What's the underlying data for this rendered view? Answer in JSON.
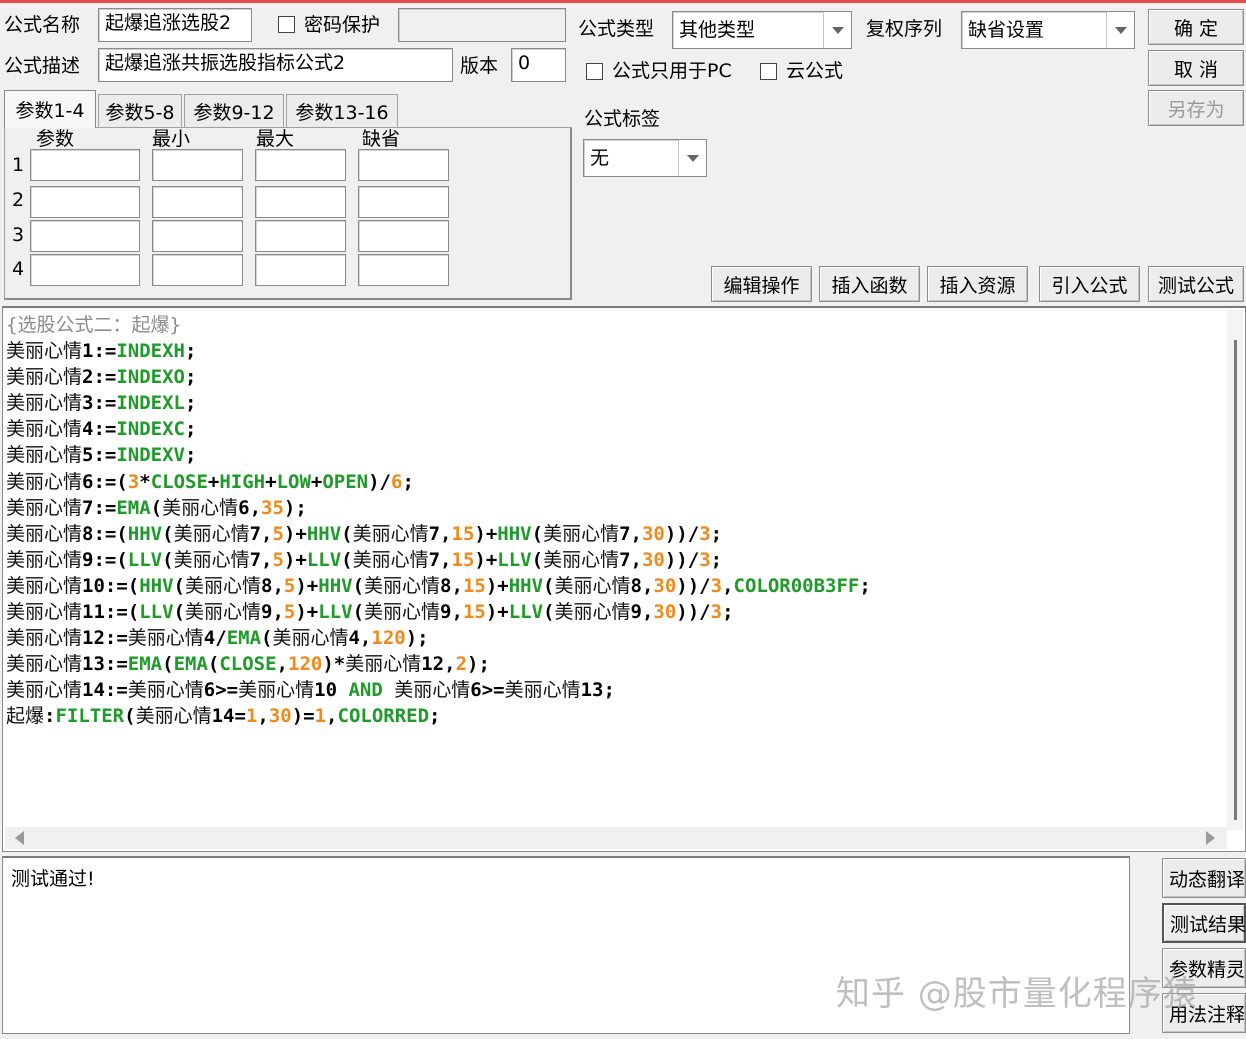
{
  "formula": {
    "name_label": "公式名称",
    "name_value": "起爆追涨选股2",
    "password_label": "密码保护",
    "desc_label": "公式描述",
    "desc_value": "起爆追涨共振选股指标公式2",
    "version_label": "版本",
    "version_value": "0",
    "type_label": "公式类型",
    "type_value": "其他类型",
    "adjust_label": "复权序列",
    "adjust_value": "缺省设置",
    "pc_only_label": "公式只用于PC",
    "cloud_label": "云公式",
    "tag_label": "公式标签",
    "tag_value": "无"
  },
  "dialog_buttons": {
    "ok": "确 定",
    "cancel": "取 消",
    "save_as": "另存为"
  },
  "params": {
    "tabs": [
      "参数1-4",
      "参数5-8",
      "参数9-12",
      "参数13-16"
    ],
    "headers": [
      "参数",
      "最小",
      "最大",
      "缺省"
    ],
    "rows": [
      "1",
      "2",
      "3",
      "4"
    ]
  },
  "action_buttons": {
    "edit": "编辑操作",
    "insert_func": "插入函数",
    "insert_res": "插入资源",
    "import": "引入公式",
    "test": "测试公式"
  },
  "code_lines": [
    [
      {
        "t": "{选股公式二：起爆}",
        "c": "cm"
      }
    ],
    [
      {
        "t": "美丽心情",
        "c": "nm"
      },
      {
        "t": "1:=",
        "c": "op"
      },
      {
        "t": "INDEXH",
        "c": "fn"
      },
      {
        "t": ";",
        "c": "op"
      }
    ],
    [
      {
        "t": "美丽心情",
        "c": "nm"
      },
      {
        "t": "2:=",
        "c": "op"
      },
      {
        "t": "INDEXO",
        "c": "fn"
      },
      {
        "t": ";",
        "c": "op"
      }
    ],
    [
      {
        "t": "美丽心情",
        "c": "nm"
      },
      {
        "t": "3:=",
        "c": "op"
      },
      {
        "t": "INDEXL",
        "c": "fn"
      },
      {
        "t": ";",
        "c": "op"
      }
    ],
    [
      {
        "t": "美丽心情",
        "c": "nm"
      },
      {
        "t": "4:=",
        "c": "op"
      },
      {
        "t": "INDEXC",
        "c": "fn"
      },
      {
        "t": ";",
        "c": "op"
      }
    ],
    [
      {
        "t": "美丽心情",
        "c": "nm"
      },
      {
        "t": "5:=",
        "c": "op"
      },
      {
        "t": "INDEXV",
        "c": "fn"
      },
      {
        "t": ";",
        "c": "op"
      }
    ],
    [
      {
        "t": "美丽心情",
        "c": "nm"
      },
      {
        "t": "6:=(",
        "c": "op"
      },
      {
        "t": "3",
        "c": "num"
      },
      {
        "t": "*",
        "c": "op"
      },
      {
        "t": "CLOSE",
        "c": "fn"
      },
      {
        "t": "+",
        "c": "op"
      },
      {
        "t": "HIGH",
        "c": "fn"
      },
      {
        "t": "+",
        "c": "op"
      },
      {
        "t": "LOW",
        "c": "fn"
      },
      {
        "t": "+",
        "c": "op"
      },
      {
        "t": "OPEN",
        "c": "fn"
      },
      {
        "t": ")/",
        "c": "op"
      },
      {
        "t": "6",
        "c": "num"
      },
      {
        "t": ";",
        "c": "op"
      }
    ],
    [
      {
        "t": "美丽心情",
        "c": "nm"
      },
      {
        "t": "7:=",
        "c": "op"
      },
      {
        "t": "EMA",
        "c": "fn"
      },
      {
        "t": "(",
        "c": "op"
      },
      {
        "t": "美丽心情",
        "c": "nm"
      },
      {
        "t": "6,",
        "c": "op"
      },
      {
        "t": "35",
        "c": "num"
      },
      {
        "t": ");",
        "c": "op"
      }
    ],
    [
      {
        "t": "美丽心情",
        "c": "nm"
      },
      {
        "t": "8:=(",
        "c": "op"
      },
      {
        "t": "HHV",
        "c": "fn"
      },
      {
        "t": "(",
        "c": "op"
      },
      {
        "t": "美丽心情",
        "c": "nm"
      },
      {
        "t": "7,",
        "c": "op"
      },
      {
        "t": "5",
        "c": "num"
      },
      {
        "t": ")+",
        "c": "op"
      },
      {
        "t": "HHV",
        "c": "fn"
      },
      {
        "t": "(",
        "c": "op"
      },
      {
        "t": "美丽心情",
        "c": "nm"
      },
      {
        "t": "7,",
        "c": "op"
      },
      {
        "t": "15",
        "c": "num"
      },
      {
        "t": ")+",
        "c": "op"
      },
      {
        "t": "HHV",
        "c": "fn"
      },
      {
        "t": "(",
        "c": "op"
      },
      {
        "t": "美丽心情",
        "c": "nm"
      },
      {
        "t": "7,",
        "c": "op"
      },
      {
        "t": "30",
        "c": "num"
      },
      {
        "t": "))/",
        "c": "op"
      },
      {
        "t": "3",
        "c": "num"
      },
      {
        "t": ";",
        "c": "op"
      }
    ],
    [
      {
        "t": "美丽心情",
        "c": "nm"
      },
      {
        "t": "9:=(",
        "c": "op"
      },
      {
        "t": "LLV",
        "c": "fn"
      },
      {
        "t": "(",
        "c": "op"
      },
      {
        "t": "美丽心情",
        "c": "nm"
      },
      {
        "t": "7,",
        "c": "op"
      },
      {
        "t": "5",
        "c": "num"
      },
      {
        "t": ")+",
        "c": "op"
      },
      {
        "t": "LLV",
        "c": "fn"
      },
      {
        "t": "(",
        "c": "op"
      },
      {
        "t": "美丽心情",
        "c": "nm"
      },
      {
        "t": "7,",
        "c": "op"
      },
      {
        "t": "15",
        "c": "num"
      },
      {
        "t": ")+",
        "c": "op"
      },
      {
        "t": "LLV",
        "c": "fn"
      },
      {
        "t": "(",
        "c": "op"
      },
      {
        "t": "美丽心情",
        "c": "nm"
      },
      {
        "t": "7,",
        "c": "op"
      },
      {
        "t": "30",
        "c": "num"
      },
      {
        "t": "))/",
        "c": "op"
      },
      {
        "t": "3",
        "c": "num"
      },
      {
        "t": ";",
        "c": "op"
      }
    ],
    [
      {
        "t": "美丽心情",
        "c": "nm"
      },
      {
        "t": "10:=(",
        "c": "op"
      },
      {
        "t": "HHV",
        "c": "fn"
      },
      {
        "t": "(",
        "c": "op"
      },
      {
        "t": "美丽心情",
        "c": "nm"
      },
      {
        "t": "8,",
        "c": "op"
      },
      {
        "t": "5",
        "c": "num"
      },
      {
        "t": ")+",
        "c": "op"
      },
      {
        "t": "HHV",
        "c": "fn"
      },
      {
        "t": "(",
        "c": "op"
      },
      {
        "t": "美丽心情",
        "c": "nm"
      },
      {
        "t": "8,",
        "c": "op"
      },
      {
        "t": "15",
        "c": "num"
      },
      {
        "t": ")+",
        "c": "op"
      },
      {
        "t": "HHV",
        "c": "fn"
      },
      {
        "t": "(",
        "c": "op"
      },
      {
        "t": "美丽心情",
        "c": "nm"
      },
      {
        "t": "8,",
        "c": "op"
      },
      {
        "t": "30",
        "c": "num"
      },
      {
        "t": "))/",
        "c": "op"
      },
      {
        "t": "3",
        "c": "num"
      },
      {
        "t": ",",
        "c": "op"
      },
      {
        "t": "COLOR00B3FF",
        "c": "cl"
      },
      {
        "t": ";",
        "c": "op"
      }
    ],
    [
      {
        "t": "美丽心情",
        "c": "nm"
      },
      {
        "t": "11:=(",
        "c": "op"
      },
      {
        "t": "LLV",
        "c": "fn"
      },
      {
        "t": "(",
        "c": "op"
      },
      {
        "t": "美丽心情",
        "c": "nm"
      },
      {
        "t": "9,",
        "c": "op"
      },
      {
        "t": "5",
        "c": "num"
      },
      {
        "t": ")+",
        "c": "op"
      },
      {
        "t": "LLV",
        "c": "fn"
      },
      {
        "t": "(",
        "c": "op"
      },
      {
        "t": "美丽心情",
        "c": "nm"
      },
      {
        "t": "9,",
        "c": "op"
      },
      {
        "t": "15",
        "c": "num"
      },
      {
        "t": ")+",
        "c": "op"
      },
      {
        "t": "LLV",
        "c": "fn"
      },
      {
        "t": "(",
        "c": "op"
      },
      {
        "t": "美丽心情",
        "c": "nm"
      },
      {
        "t": "9,",
        "c": "op"
      },
      {
        "t": "30",
        "c": "num"
      },
      {
        "t": "))/",
        "c": "op"
      },
      {
        "t": "3",
        "c": "num"
      },
      {
        "t": ";",
        "c": "op"
      }
    ],
    [
      {
        "t": "美丽心情",
        "c": "nm"
      },
      {
        "t": "12:=",
        "c": "op"
      },
      {
        "t": "美丽心情",
        "c": "nm"
      },
      {
        "t": "4/",
        "c": "op"
      },
      {
        "t": "EMA",
        "c": "fn"
      },
      {
        "t": "(",
        "c": "op"
      },
      {
        "t": "美丽心情",
        "c": "nm"
      },
      {
        "t": "4,",
        "c": "op"
      },
      {
        "t": "120",
        "c": "num"
      },
      {
        "t": ");",
        "c": "op"
      }
    ],
    [
      {
        "t": "美丽心情",
        "c": "nm"
      },
      {
        "t": "13:=",
        "c": "op"
      },
      {
        "t": "EMA",
        "c": "fn"
      },
      {
        "t": "(",
        "c": "op"
      },
      {
        "t": "EMA",
        "c": "fn"
      },
      {
        "t": "(",
        "c": "op"
      },
      {
        "t": "CLOSE",
        "c": "fn"
      },
      {
        "t": ",",
        "c": "op"
      },
      {
        "t": "120",
        "c": "num"
      },
      {
        "t": ")*",
        "c": "op"
      },
      {
        "t": "美丽心情",
        "c": "nm"
      },
      {
        "t": "12,",
        "c": "op"
      },
      {
        "t": "2",
        "c": "num"
      },
      {
        "t": ");",
        "c": "op"
      }
    ],
    [
      {
        "t": "美丽心情",
        "c": "nm"
      },
      {
        "t": "14:=",
        "c": "op"
      },
      {
        "t": "美丽心情",
        "c": "nm"
      },
      {
        "t": "6>=",
        "c": "op"
      },
      {
        "t": "美丽心情",
        "c": "nm"
      },
      {
        "t": "10 ",
        "c": "op"
      },
      {
        "t": "AND",
        "c": "fn"
      },
      {
        "t": " ",
        "c": "op"
      },
      {
        "t": "美丽心情",
        "c": "nm"
      },
      {
        "t": "6>=",
        "c": "op"
      },
      {
        "t": "美丽心情",
        "c": "nm"
      },
      {
        "t": "13;",
        "c": "op"
      }
    ],
    [
      {
        "t": "起爆",
        "c": "nm"
      },
      {
        "t": ":",
        "c": "op"
      },
      {
        "t": "FILTER",
        "c": "fn"
      },
      {
        "t": "(",
        "c": "op"
      },
      {
        "t": "美丽心情",
        "c": "nm"
      },
      {
        "t": "14=",
        "c": "op"
      },
      {
        "t": "1",
        "c": "num"
      },
      {
        "t": ",",
        "c": "op"
      },
      {
        "t": "30",
        "c": "num"
      },
      {
        "t": ")=",
        "c": "op"
      },
      {
        "t": "1",
        "c": "num"
      },
      {
        "t": ",",
        "c": "op"
      },
      {
        "t": "COLORRED",
        "c": "cl"
      },
      {
        "t": ";",
        "c": "op"
      }
    ]
  ],
  "output": {
    "text": "测试通过!"
  },
  "side_buttons": {
    "dynamic_translate": "动态翻译",
    "test_result": "测试结果",
    "param_wizard": "参数精灵",
    "usage_notes": "用法注释"
  },
  "watermark": "知乎 @股市量化程序猿"
}
